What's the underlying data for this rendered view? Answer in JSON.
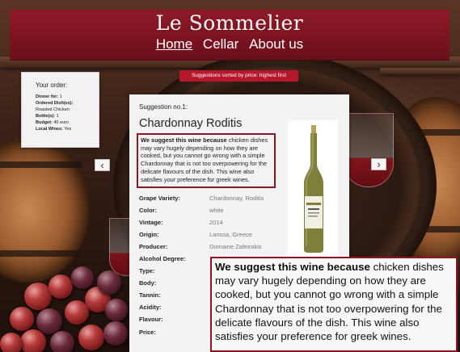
{
  "header": {
    "title": "Le Sommelier",
    "nav": [
      "Home",
      "Cellar",
      "About us"
    ],
    "active_nav": "Home"
  },
  "order": {
    "title": "Your order:",
    "items": [
      {
        "label": "Dinner for:",
        "value": "1"
      },
      {
        "label": "Ordered Dish(es):",
        "value": ""
      },
      {
        "label": "",
        "value": "Roasted Chicken"
      },
      {
        "label": "Bottle(s):",
        "value": "1"
      },
      {
        "label": "Budget:",
        "value": "40 euro"
      },
      {
        "label": "Local Wines:",
        "value": "Yes"
      }
    ]
  },
  "sort_banner": "Suggestions sorted by price: highest first",
  "suggestion": {
    "number_label": "Suggestion no.1:",
    "wine_name": "Chardonnay Roditis",
    "reason_lead": "We suggest this wine because",
    "reason_text": "chicken dishes may vary hugely depending on how they are cooked, but you cannot go wrong with a simple Chardonnay that is not too overpowering for the delicate flavours of the dish. This wine also satisfies your preference for greek wines.",
    "details": [
      {
        "label": "Grape Variety:",
        "value": "Chardonnay, Roditis"
      },
      {
        "label": "Color:",
        "value": "white"
      },
      {
        "label": "Vintage:",
        "value": "2014"
      },
      {
        "label": "Origin:",
        "value": "Larissa, Greece"
      },
      {
        "label": "Producer:",
        "value": "Domaine Zafeirakis"
      },
      {
        "label": "Alcohol Degree:",
        "value": ""
      },
      {
        "label": "Type:",
        "value": ""
      },
      {
        "label": "Body:",
        "value": ""
      },
      {
        "label": "Tannin:",
        "value": ""
      },
      {
        "label": "Acidity:",
        "value": ""
      },
      {
        "label": "Flavour:",
        "value": ""
      },
      {
        "label": "Price:",
        "value": ""
      }
    ]
  },
  "arrows": {
    "prev": "‹",
    "next": "›"
  },
  "colors": {
    "header_red": "#7a1320",
    "accent_red": "#b6172a",
    "border_red": "#8c1624",
    "card_bg": "#f3f3f3"
  }
}
